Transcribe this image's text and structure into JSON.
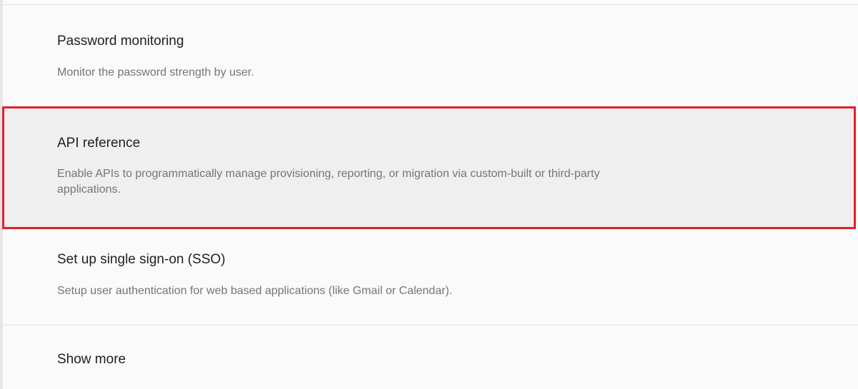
{
  "items": [
    {
      "title": "Password monitoring",
      "description": "Monitor the password strength by user."
    },
    {
      "title": "API reference",
      "description": "Enable APIs to programmatically manage provisioning, reporting, or migration via custom-built or third-party applications."
    },
    {
      "title": "Set up single sign-on (SSO)",
      "description": "Setup user authentication for web based applications (like Gmail or Calendar)."
    }
  ],
  "show_more": "Show more",
  "highlight_color": "#e5202a"
}
